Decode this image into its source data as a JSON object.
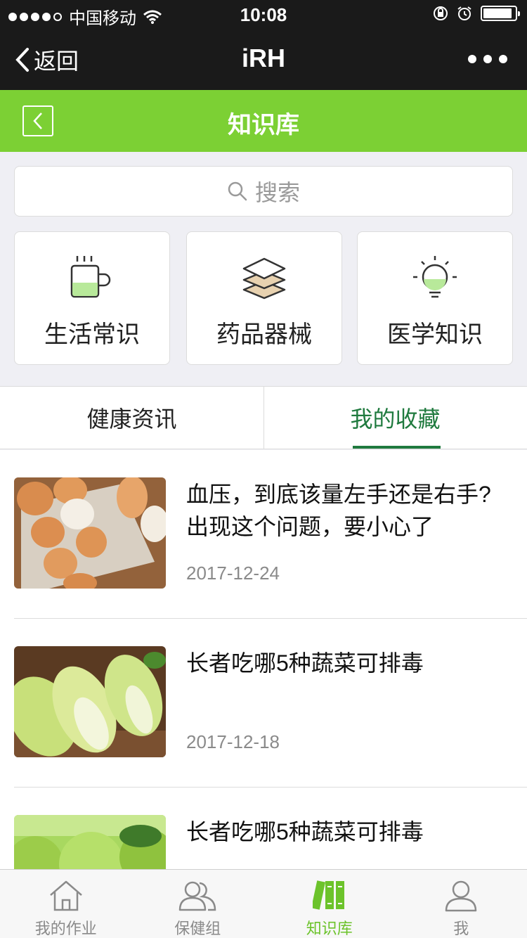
{
  "status_bar": {
    "carrier": "中国移动",
    "time": "10:08"
  },
  "nav": {
    "back_label": "返回",
    "title": "iRH"
  },
  "header": {
    "title": "知识库"
  },
  "search": {
    "placeholder": "搜索"
  },
  "categories": [
    {
      "label": "生活常识",
      "icon": "cup-icon"
    },
    {
      "label": "药品器械",
      "icon": "layers-icon"
    },
    {
      "label": "医学知识",
      "icon": "bulb-icon"
    }
  ],
  "tabs": [
    {
      "label": "健康资讯",
      "active": false
    },
    {
      "label": "我的收藏",
      "active": true
    }
  ],
  "articles": [
    {
      "title": "血压，到底该量左手还是右手?出现这个问题，要小心了",
      "date": "2017-12-24",
      "thumb": "eggs"
    },
    {
      "title": "长者吃哪5种蔬菜可排毒",
      "date": "2017-12-18",
      "thumb": "cabbage"
    },
    {
      "title": "长者吃哪5种蔬菜可排毒",
      "date": "",
      "thumb": "apples"
    }
  ],
  "tabbar": [
    {
      "label": "我的作业",
      "icon": "home-icon",
      "active": false
    },
    {
      "label": "保健组",
      "icon": "group-icon",
      "active": false
    },
    {
      "label": "知识库",
      "icon": "books-icon",
      "active": true
    },
    {
      "label": "我",
      "icon": "user-icon",
      "active": false
    }
  ],
  "colors": {
    "accent_green": "#7cd034",
    "tab_active": "#1f7a3e",
    "dark_bar": "#1a1a1a"
  }
}
